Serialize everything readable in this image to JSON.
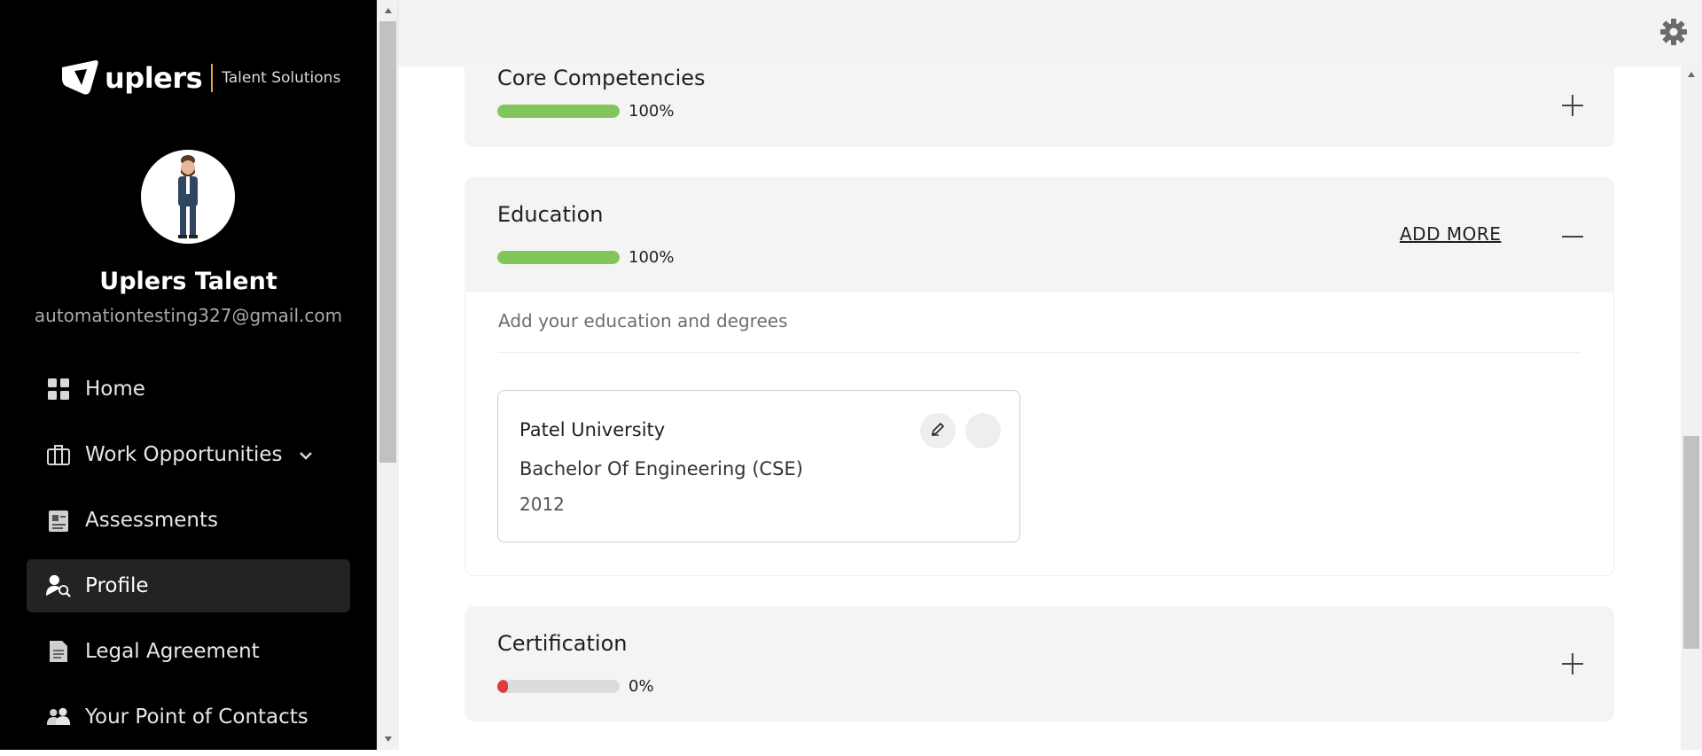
{
  "brand": {
    "name": "uplers",
    "tagline": "Talent Solutions"
  },
  "user": {
    "name": "Uplers Talent",
    "email": "automationtesting327@gmail.com"
  },
  "nav": [
    {
      "label": "Home",
      "icon": "grid-icon"
    },
    {
      "label": "Work Opportunities",
      "icon": "briefcase-icon",
      "has_dropdown": true
    },
    {
      "label": "Assessments",
      "icon": "clipboard-icon"
    },
    {
      "label": "Profile",
      "icon": "profile-search-icon",
      "active": true
    },
    {
      "label": "Legal Agreement",
      "icon": "document-icon"
    },
    {
      "label": "Your Point of Contacts",
      "icon": "contacts-icon"
    }
  ],
  "sections": {
    "core": {
      "title": "Core Competencies",
      "progress": 100,
      "progress_text": "100%",
      "color": "#82c55b"
    },
    "education": {
      "title": "Education",
      "progress": 100,
      "progress_text": "100%",
      "color": "#82c55b",
      "add_more": "ADD MORE",
      "description": "Add your education and degrees",
      "entries": [
        {
          "school": "Patel University",
          "degree": "Bachelor Of Engineering (CSE)",
          "year": "2012"
        }
      ]
    },
    "certification": {
      "title": "Certification",
      "progress": 0,
      "progress_text": "0%",
      "color": "#e03a3a"
    }
  },
  "colors": {
    "sidebar_bg": "#000000",
    "accent_green": "#82c55b",
    "accent_red": "#e03a3a"
  }
}
